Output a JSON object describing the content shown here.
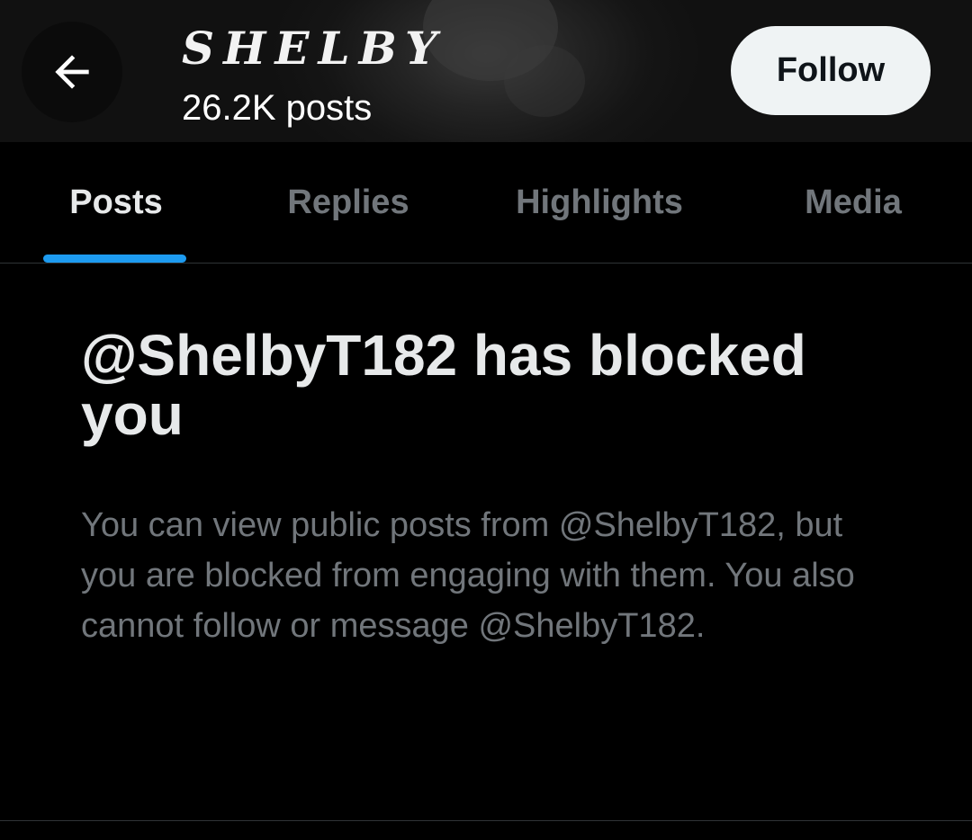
{
  "header": {
    "display_name": "SHELBY",
    "post_count": "26.2K posts",
    "back_icon": "arrow-left-icon",
    "follow_label": "Follow"
  },
  "tabs": [
    {
      "label": "Posts",
      "active": true
    },
    {
      "label": "Replies",
      "active": false
    },
    {
      "label": "Highlights",
      "active": false
    },
    {
      "label": "Media",
      "active": false
    }
  ],
  "blocked": {
    "title": "@ShelbyT182 has blocked you",
    "message": "You can view public posts from @ShelbyT182, but you are blocked from engaging with them. You also cannot follow or message @ShelbyT182."
  },
  "colors": {
    "background": "#000000",
    "accent": "#1d9bf0",
    "primary_text": "#e7e9ea",
    "secondary_text": "#71767b",
    "follow_button_bg": "#eff3f4"
  }
}
